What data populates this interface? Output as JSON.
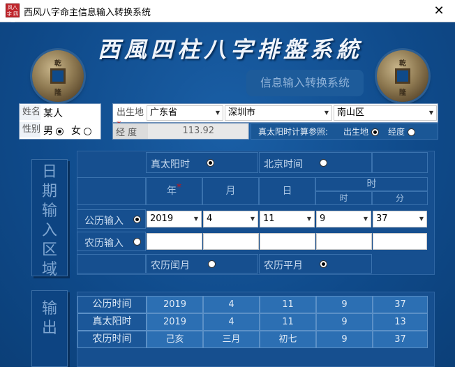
{
  "window": {
    "title": "西风八字命主信息输入转换系统",
    "icon_text": "风八字 四柱",
    "close_glyph": "✕"
  },
  "banner": {
    "title": "西風四柱八字排盤系統",
    "subtitle": "信息输入转换系统"
  },
  "coins": {
    "left": [
      "乾",
      "隆"
    ],
    "right": [
      "乾",
      "隆"
    ]
  },
  "person": {
    "name_label": "姓名",
    "name_value": "某人",
    "gender_label": "性别",
    "male": "男",
    "female": "女",
    "gender_selected": "male"
  },
  "location": {
    "birthplace_label": "出生地",
    "required_mark": "*",
    "province": "广东省",
    "city": "深圳市",
    "district": "南山区",
    "longitude_label": "经 度",
    "longitude_value": "113.92",
    "solar_ref_label": "真太阳时计算参照:",
    "ref_birthplace": "出生地",
    "ref_longitude": "经度",
    "ref_selected": "birthplace"
  },
  "date_input": {
    "section_label": [
      "日",
      "期",
      "输",
      "入",
      "区",
      "域"
    ],
    "true_solar_label": "真太阳时",
    "beijing_time_label": "北京时间",
    "time_mode_selected": "true_solar",
    "col_year": "年",
    "col_year_required": "*",
    "col_month": "月",
    "col_day": "日",
    "col_time": "时",
    "col_hour": "时",
    "col_minute": "分",
    "gregorian_label": "公历输入",
    "lunar_label": "农历输入",
    "input_mode_selected": "gregorian",
    "gregorian_values": {
      "year": "2019",
      "month": "4",
      "day": "11",
      "hour": "9",
      "minute": "37"
    },
    "leap_month_label": "农历闰月",
    "normal_month_label": "农历平月",
    "month_type_selected": "normal"
  },
  "output": {
    "section_label": [
      "输",
      "出"
    ],
    "rows": [
      {
        "label": "公历时间",
        "values": [
          "2019",
          "4",
          "11",
          "9",
          "37"
        ]
      },
      {
        "label": "真太阳时",
        "values": [
          "2019",
          "4",
          "11",
          "9",
          "13"
        ]
      },
      {
        "label": "农历时间",
        "values": [
          "己亥",
          "三月",
          "初七",
          "9",
          "37"
        ]
      }
    ]
  }
}
